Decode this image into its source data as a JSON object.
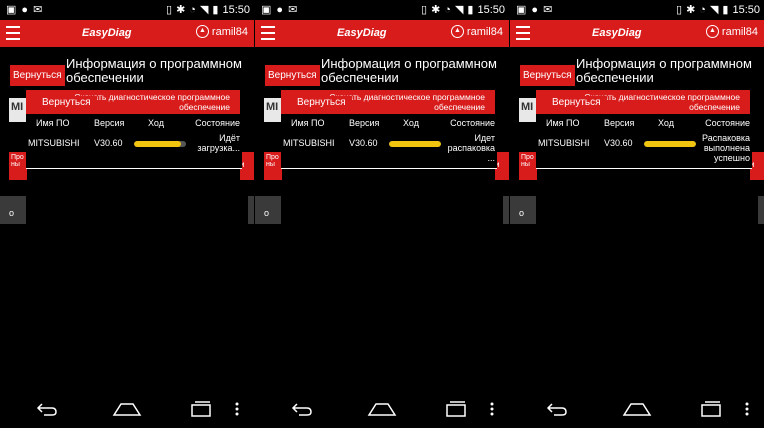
{
  "status_bar": {
    "time": "15:50"
  },
  "app": {
    "name": "EasyDiag",
    "user": "ramil84"
  },
  "page": {
    "back_label": "Вернуться",
    "title": "Информация о программном обеспечении",
    "bg_card_text": "MI",
    "bg_red_text": "Про ны",
    "bg_red_right_text": "и",
    "bg_gray_text": "о"
  },
  "dialog": {
    "download_label": "Скачать диагностическое программное обеспечение",
    "columns": [
      "Имя ПО",
      "Версия",
      "Ход",
      "Состояние"
    ],
    "software_name": "MITSUBISHI",
    "version": "V30.60"
  },
  "panels": [
    {
      "status": "Идёт загрузка...",
      "progress": 0.9
    },
    {
      "status": "Идет распаковка ...",
      "progress": 1.0
    },
    {
      "status": "Распаковка выполнена успешно",
      "progress": 1.0
    }
  ],
  "colors": {
    "accent": "#d81c1c",
    "progress": "#f1c40f",
    "background": "#000000"
  },
  "icons": [
    "image-icon",
    "chat-icon",
    "mail-icon",
    "vibrate-icon",
    "bluetooth-icon",
    "alarm-icon",
    "wifi-icon",
    "signal-icon",
    "battery-icon",
    "menu-icon",
    "user-icon",
    "back-nav-icon",
    "home-nav-icon",
    "recents-nav-icon",
    "overflow-icon"
  ]
}
